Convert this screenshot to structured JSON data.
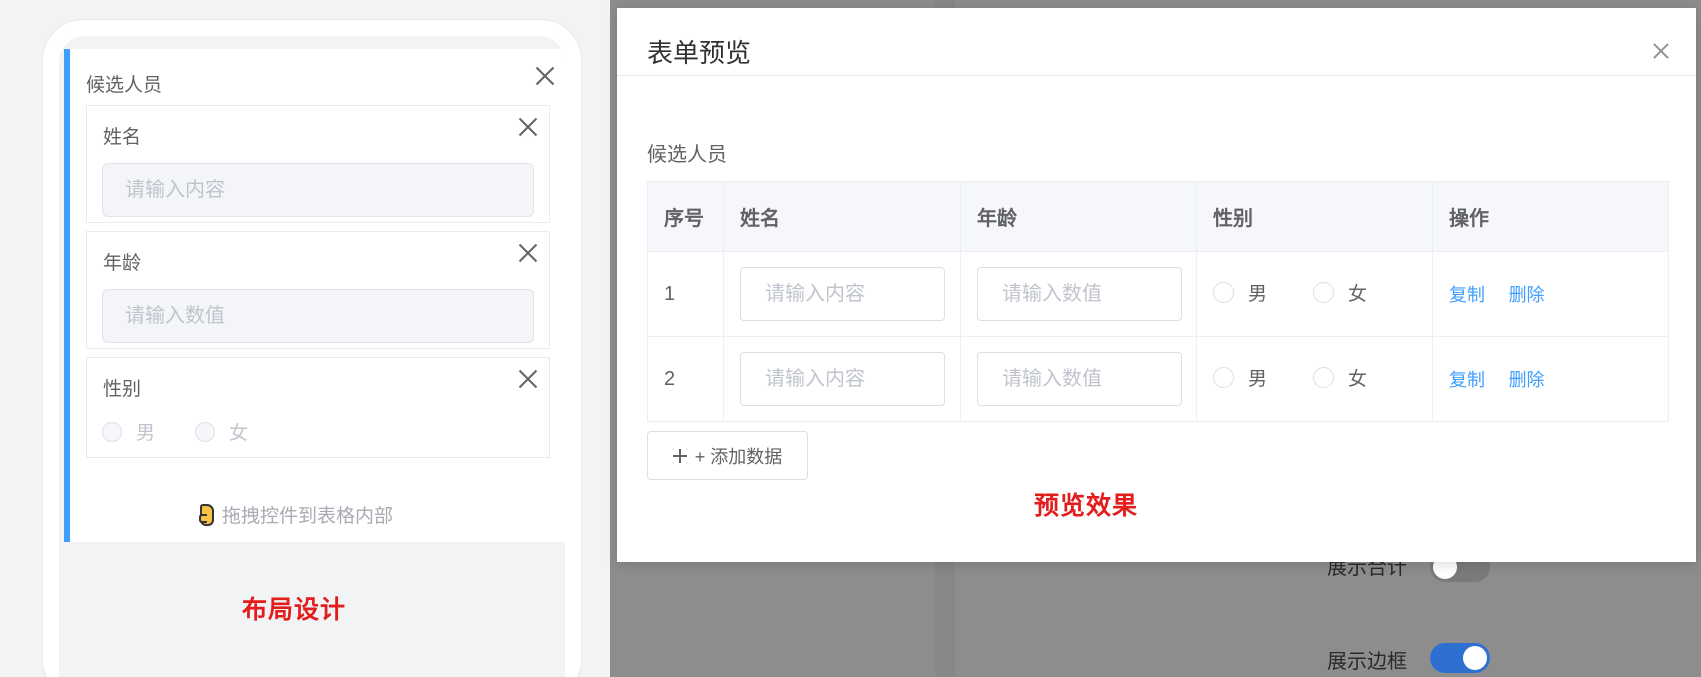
{
  "designer": {
    "subform_title": "候选人员",
    "fields": [
      {
        "label": "姓名",
        "placeholder": "请输入内容"
      },
      {
        "label": "年龄",
        "placeholder": "请输入数值"
      },
      {
        "label": "性别",
        "options": [
          "男",
          "女"
        ]
      }
    ],
    "drag_hint": "拖拽控件到表格内部",
    "caption": "布局设计"
  },
  "background": {
    "labels": {
      "show_total": "展示合计",
      "show_border": "展示边框"
    },
    "toggles": {
      "show_total": false,
      "show_border": true
    },
    "accent_color": "#2f6fd1"
  },
  "dialog": {
    "title": "表单预览",
    "form_label": "候选人员",
    "columns": [
      "序号",
      "姓名",
      "年龄",
      "性别",
      "操作"
    ],
    "rows": [
      {
        "index": "1",
        "name_placeholder": "请输入内容",
        "age_placeholder": "请输入数值",
        "gender_options": [
          "男",
          "女"
        ],
        "actions": [
          "复制",
          "删除"
        ]
      },
      {
        "index": "2",
        "name_placeholder": "请输入内容",
        "age_placeholder": "请输入数值",
        "gender_options": [
          "男",
          "女"
        ],
        "actions": [
          "复制",
          "删除"
        ]
      }
    ],
    "add_button": "+ 添加数据",
    "caption": "预览效果"
  },
  "colors": {
    "primary": "#409eff",
    "caption_red": "#e31c1c"
  }
}
